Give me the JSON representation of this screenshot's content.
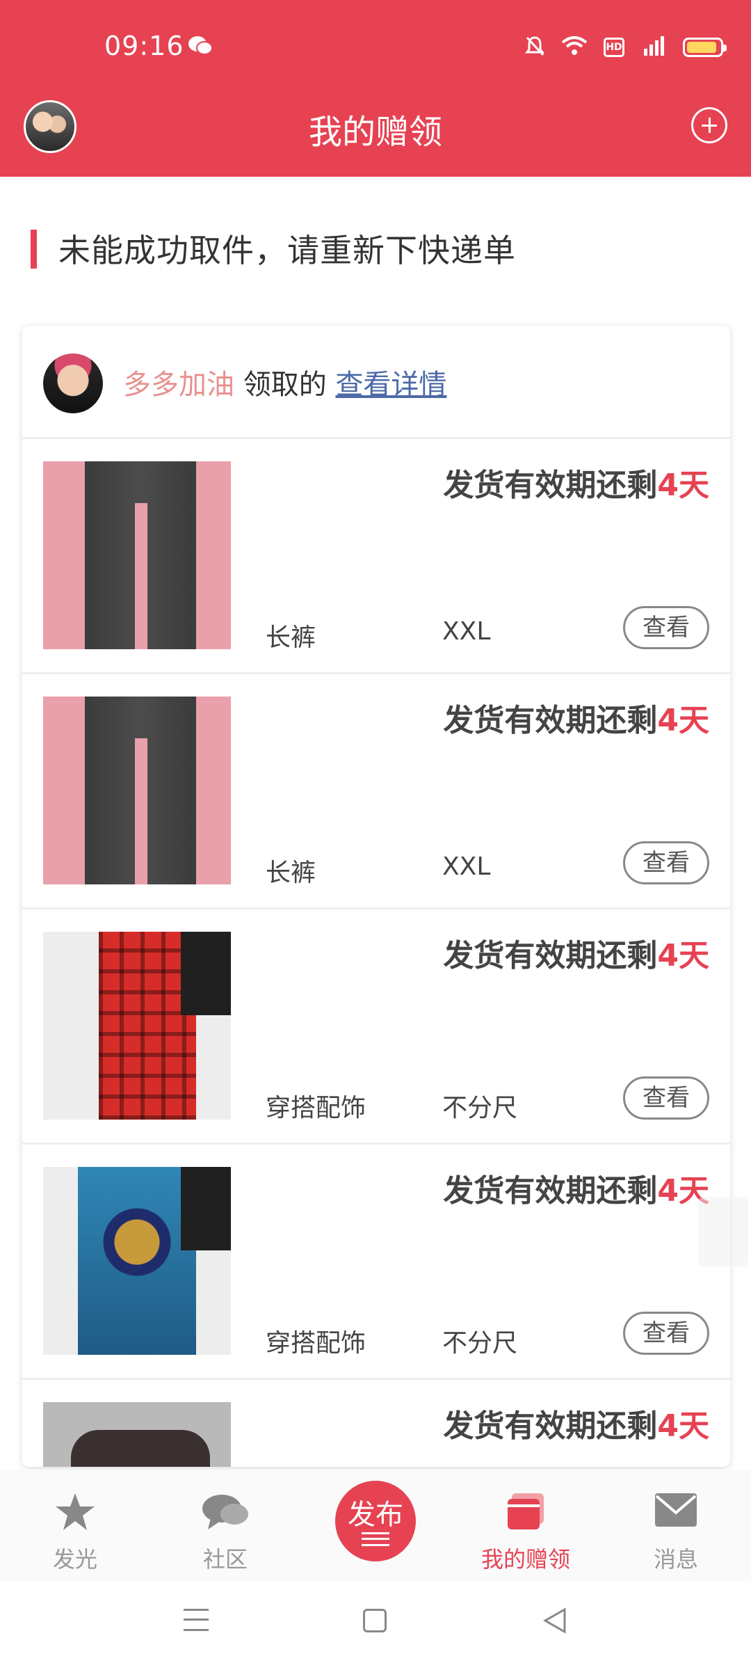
{
  "status_bar": {
    "time": "09:16"
  },
  "header": {
    "title": "我的赠领"
  },
  "notice": {
    "text": "未能成功取件，请重新下快递单"
  },
  "card": {
    "user_name": "多多加油",
    "claimed_text": " 领取的 ",
    "detail_link": "查看详情",
    "items": [
      {
        "deadline_prefix": "发货有效期还剩",
        "days": "4天",
        "category": "长裤",
        "size": "XXL",
        "view_label": "查看"
      },
      {
        "deadline_prefix": "发货有效期还剩",
        "days": "4天",
        "category": "长裤",
        "size": "XXL",
        "view_label": "查看"
      },
      {
        "deadline_prefix": "发货有效期还剩",
        "days": "4天",
        "category": "穿搭配饰",
        "size": "不分尺",
        "view_label": "查看"
      },
      {
        "deadline_prefix": "发货有效期还剩",
        "days": "4天",
        "category": "穿搭配饰",
        "size": "不分尺",
        "view_label": "查看"
      },
      {
        "deadline_prefix": "发货有效期还剩",
        "days": "4天",
        "category": "",
        "size": "",
        "view_label": ""
      }
    ]
  },
  "bottom_nav": {
    "items": [
      {
        "label": "发光",
        "icon": "star-icon"
      },
      {
        "label": "社区",
        "icon": "chat-bubble-icon"
      },
      {
        "label": "发布",
        "icon": "publish-icon"
      },
      {
        "label": "我的赠领",
        "icon": "gift-box-icon"
      },
      {
        "label": "消息",
        "icon": "mail-icon"
      }
    ]
  },
  "colors": {
    "accent": "#e64252",
    "link": "#4d6aa8",
    "username": "#e89090"
  }
}
